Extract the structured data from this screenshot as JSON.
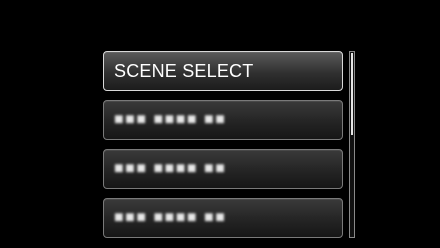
{
  "menu": {
    "items": [
      {
        "label": "SCENE SELECT",
        "selected": true
      },
      {
        "label": "■■■ ■■■■ ■■",
        "selected": false
      },
      {
        "label": "■■■ ■■■■ ■■",
        "selected": false
      },
      {
        "label": "■■■ ■■■■ ■■",
        "selected": false
      }
    ]
  },
  "scrollbar": {
    "position_fraction": 0.0,
    "visible_fraction": 0.45
  },
  "colors": {
    "background": "#000000",
    "item_border": "#7a7a7a",
    "selected_border": "#d8d8d8",
    "text": "#ffffff"
  }
}
